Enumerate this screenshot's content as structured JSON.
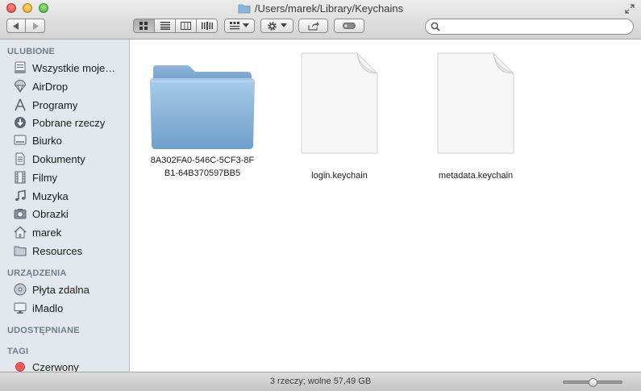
{
  "window": {
    "title": "/Users/marek/Library/Keychains"
  },
  "toolbar": {
    "search": {
      "value": "",
      "placeholder": ""
    },
    "view_mode": "icons"
  },
  "sidebar": {
    "sections": {
      "favorites": "ULUBIONE",
      "devices": "URZĄDZENIA",
      "shared": "UDOSTĘPNIANE",
      "tags": "TAGI"
    },
    "favorites": [
      {
        "label": "Wszystkie moje…",
        "icon": "all-files-icon"
      },
      {
        "label": "AirDrop",
        "icon": "airdrop-icon"
      },
      {
        "label": "Programy",
        "icon": "applications-icon"
      },
      {
        "label": "Pobrane rzeczy",
        "icon": "downloads-icon"
      },
      {
        "label": "Biurko",
        "icon": "desktop-icon"
      },
      {
        "label": "Dokumenty",
        "icon": "documents-icon"
      },
      {
        "label": "Filmy",
        "icon": "movies-icon"
      },
      {
        "label": "Muzyka",
        "icon": "music-icon"
      },
      {
        "label": "Obrazki",
        "icon": "pictures-icon"
      },
      {
        "label": "marek",
        "icon": "home-icon"
      },
      {
        "label": "Resources",
        "icon": "folder-icon"
      }
    ],
    "devices": [
      {
        "label": "Płyta zdalna",
        "icon": "remote-disc-icon"
      },
      {
        "label": "iMadlo",
        "icon": "computer-icon"
      }
    ],
    "tags": [
      {
        "label": "Czerwony",
        "color": "#ee5a5a"
      }
    ]
  },
  "files": [
    {
      "name_line1": "8A302FA0-546C-5CF3-8F",
      "name_line2": "B1-64B370597BB5",
      "type": "folder"
    },
    {
      "name_line1": "login.keychain",
      "type": "document"
    },
    {
      "name_line1": "metadata.keychain",
      "type": "document"
    }
  ],
  "status": {
    "text": "3 rzeczy; wolne 57,49 GB",
    "icon_size_fraction": 0.5
  },
  "colors": {
    "folder_blue": "#8db5d8",
    "sidebar_bg": "#e3e8ee",
    "tag_red": "#ee5a5a"
  }
}
